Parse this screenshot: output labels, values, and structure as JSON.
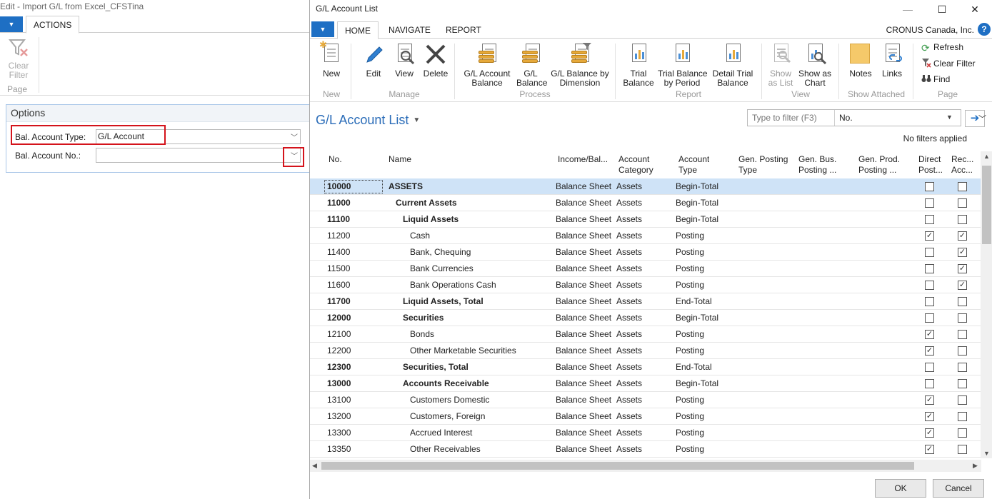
{
  "bg_window": {
    "title": "Edit - Import G/L from Excel_CFSTina",
    "tab_actions": "ACTIONS",
    "clear_filter": "Clear Filter",
    "group_page": "Page",
    "options_title": "Options",
    "bal_account_type_label": "Bal. Account Type:",
    "bal_account_type_value": "G/L Account",
    "bal_account_no_label": "Bal. Account No.:",
    "bal_account_no_value": ""
  },
  "dialog": {
    "title": "G/L Account List",
    "tabs": [
      "HOME",
      "NAVIGATE",
      "REPORT"
    ],
    "company": "CRONUS Canada, Inc.",
    "help": "?"
  },
  "ribbon": {
    "new": "New",
    "edit": "Edit",
    "view": "View",
    "delete": "Delete",
    "gl_account_balance": [
      "G/L Account",
      "Balance"
    ],
    "gl_balance": [
      "G/L",
      "Balance"
    ],
    "gl_balance_by_dimension": [
      "G/L Balance by",
      "Dimension"
    ],
    "trial_balance": [
      "Trial",
      "Balance"
    ],
    "trial_balance_by_period": [
      "Trial Balance",
      "by Period"
    ],
    "detail_trial_balance": [
      "Detail Trial",
      "Balance"
    ],
    "show_as_list": [
      "Show",
      "as List"
    ],
    "show_as_chart": [
      "Show as",
      "Chart"
    ],
    "notes": "Notes",
    "links": "Links",
    "refresh": "Refresh",
    "clear_filter": "Clear Filter",
    "find": "Find",
    "groups": {
      "new": "New",
      "manage": "Manage",
      "process": "Process",
      "report": "Report",
      "view": "View",
      "show_attached": "Show Attached",
      "page": "Page"
    }
  },
  "list": {
    "title": "G/L Account List",
    "filter_placeholder": "Type to filter (F3)",
    "filter_field": "No.",
    "no_filters": "No filters applied",
    "columns": {
      "no": "No.",
      "name": "Name",
      "income_bal": "Income/Bal...",
      "category": [
        "Account",
        "Category"
      ],
      "type": [
        "Account",
        "Type"
      ],
      "gen_posting": [
        "Gen. Posting",
        "Type"
      ],
      "gen_bus": [
        "Gen. Bus.",
        "Posting ..."
      ],
      "gen_prod": [
        "Gen. Prod.",
        "Posting ..."
      ],
      "direct": [
        "Direct",
        "Post..."
      ],
      "rec": [
        "Rec...",
        "Acc..."
      ]
    },
    "rows": [
      {
        "no": "10000",
        "name": "ASSETS",
        "indent": 0,
        "bold": true,
        "selected": true,
        "income_bal": "Balance Sheet",
        "category": "Assets",
        "type": "Begin-Total",
        "direct": false,
        "rec": false
      },
      {
        "no": "11000",
        "name": "Current Assets",
        "indent": 1,
        "bold": true,
        "income_bal": "Balance Sheet",
        "category": "Assets",
        "type": "Begin-Total",
        "direct": false,
        "rec": false
      },
      {
        "no": "11100",
        "name": "Liquid Assets",
        "indent": 2,
        "bold": true,
        "income_bal": "Balance Sheet",
        "category": "Assets",
        "type": "Begin-Total",
        "direct": false,
        "rec": false
      },
      {
        "no": "11200",
        "name": "Cash",
        "indent": 3,
        "bold": false,
        "income_bal": "Balance Sheet",
        "category": "Assets",
        "type": "Posting",
        "direct": true,
        "rec": true
      },
      {
        "no": "11400",
        "name": "Bank, Chequing",
        "indent": 3,
        "bold": false,
        "income_bal": "Balance Sheet",
        "category": "Assets",
        "type": "Posting",
        "direct": false,
        "rec": true
      },
      {
        "no": "11500",
        "name": "Bank Currencies",
        "indent": 3,
        "bold": false,
        "income_bal": "Balance Sheet",
        "category": "Assets",
        "type": "Posting",
        "direct": false,
        "rec": true
      },
      {
        "no": "11600",
        "name": "Bank Operations Cash",
        "indent": 3,
        "bold": false,
        "income_bal": "Balance Sheet",
        "category": "Assets",
        "type": "Posting",
        "direct": false,
        "rec": true
      },
      {
        "no": "11700",
        "name": "Liquid Assets, Total",
        "indent": 2,
        "bold": true,
        "income_bal": "Balance Sheet",
        "category": "Assets",
        "type": "End-Total",
        "direct": false,
        "rec": false
      },
      {
        "no": "12000",
        "name": "Securities",
        "indent": 2,
        "bold": true,
        "income_bal": "Balance Sheet",
        "category": "Assets",
        "type": "Begin-Total",
        "direct": false,
        "rec": false
      },
      {
        "no": "12100",
        "name": "Bonds",
        "indent": 3,
        "bold": false,
        "income_bal": "Balance Sheet",
        "category": "Assets",
        "type": "Posting",
        "direct": true,
        "rec": false
      },
      {
        "no": "12200",
        "name": "Other Marketable Securities",
        "indent": 3,
        "bold": false,
        "income_bal": "Balance Sheet",
        "category": "Assets",
        "type": "Posting",
        "direct": true,
        "rec": false
      },
      {
        "no": "12300",
        "name": "Securities, Total",
        "indent": 2,
        "bold": true,
        "income_bal": "Balance Sheet",
        "category": "Assets",
        "type": "End-Total",
        "direct": false,
        "rec": false
      },
      {
        "no": "13000",
        "name": "Accounts Receivable",
        "indent": 2,
        "bold": true,
        "income_bal": "Balance Sheet",
        "category": "Assets",
        "type": "Begin-Total",
        "direct": false,
        "rec": false
      },
      {
        "no": "13100",
        "name": "Customers Domestic",
        "indent": 3,
        "bold": false,
        "income_bal": "Balance Sheet",
        "category": "Assets",
        "type": "Posting",
        "direct": true,
        "rec": false
      },
      {
        "no": "13200",
        "name": "Customers, Foreign",
        "indent": 3,
        "bold": false,
        "income_bal": "Balance Sheet",
        "category": "Assets",
        "type": "Posting",
        "direct": true,
        "rec": false
      },
      {
        "no": "13300",
        "name": "Accrued Interest",
        "indent": 3,
        "bold": false,
        "income_bal": "Balance Sheet",
        "category": "Assets",
        "type": "Posting",
        "direct": true,
        "rec": false
      },
      {
        "no": "13350",
        "name": "Other Receivables",
        "indent": 3,
        "bold": false,
        "income_bal": "Balance Sheet",
        "category": "Assets",
        "type": "Posting",
        "direct": true,
        "rec": false
      }
    ]
  },
  "buttons": {
    "ok": "OK",
    "cancel": "Cancel"
  },
  "colors": {
    "accent": "#1e6fc4",
    "selection": "#cfe3f7",
    "highlight_box": "#d4131b"
  }
}
